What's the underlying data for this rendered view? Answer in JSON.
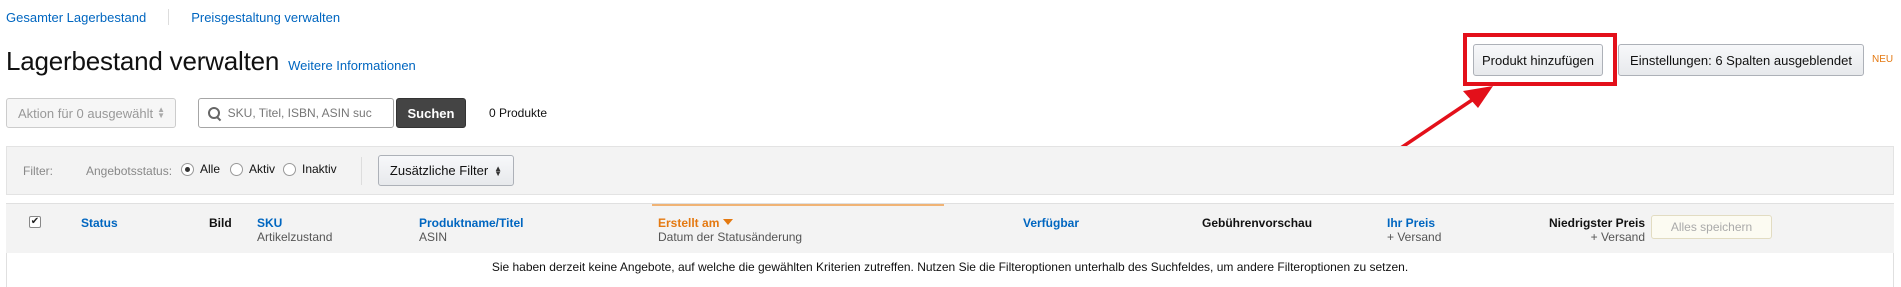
{
  "nav": {
    "link1": "Gesamter Lagerbestand",
    "link2": "Preisgestaltung verwalten"
  },
  "header": {
    "title": "Lagerbestand verwalten",
    "more_info": "Weitere Informationen",
    "add_product": "Produkt hinzufügen",
    "settings": "Einstellungen: 6 Spalten ausgeblendet",
    "new_badge": "NEU"
  },
  "toolbar": {
    "bulk_action": "Aktion für 0 ausgewählt",
    "search_placeholder": "SKU, Titel, ISBN, ASIN suc",
    "search_button": "Suchen",
    "product_count": "0 Produkte"
  },
  "filters": {
    "label": "Filter:",
    "status_label": "Angebotsstatus:",
    "options": [
      "Alle",
      "Aktiv",
      "Inaktiv"
    ],
    "selected": "Alle",
    "more_filters": "Zusätzliche Filter"
  },
  "table": {
    "columns": [
      {
        "main": "Status",
        "sub": ""
      },
      {
        "main": "Bild",
        "sub": ""
      },
      {
        "main": "SKU",
        "sub": "Artikelzustand"
      },
      {
        "main": "Produktname/Titel",
        "sub": "ASIN"
      },
      {
        "main": "Erstellt am",
        "sub": "Datum der Statusänderung"
      },
      {
        "main": "Verfügbar",
        "sub": ""
      },
      {
        "main": "Gebührenvorschau",
        "sub": ""
      },
      {
        "main": "Ihr Preis",
        "sub": "+ Versand"
      },
      {
        "main": "Niedrigster Preis",
        "sub": "+ Versand"
      }
    ],
    "save_all": "Alles speichern",
    "empty_message": "Sie haben derzeit keine Angebote, auf welche die gewählten Kriterien zutreffen. Nutzen Sie die Filteroptionen unterhalb des Suchfeldes, um andere Filteroptionen zu setzen."
  },
  "colors": {
    "link": "#0066c0",
    "accent_orange": "#e47911",
    "highlight_red": "#e3101a"
  }
}
